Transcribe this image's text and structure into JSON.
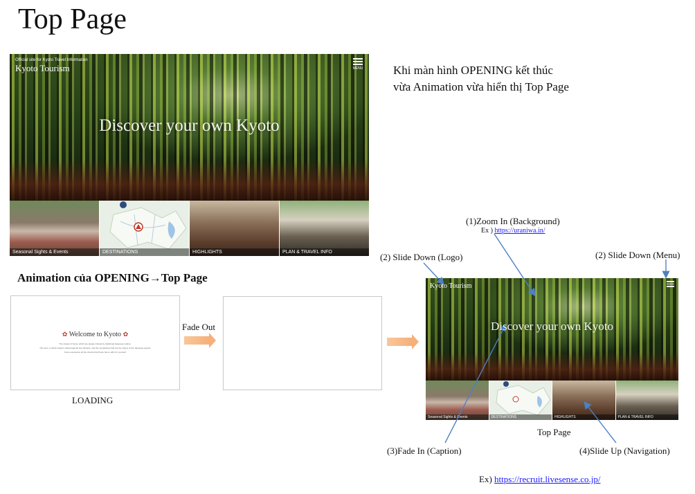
{
  "page_title": "Top Page",
  "hero_main": {
    "site_tagline": "Official site for Kyoto Travel Information",
    "logo": "Kyoto Tourism",
    "menu_label": "MENU",
    "caption": "Discover your own Kyoto"
  },
  "nav_tiles": [
    {
      "label": "Seasonal Sights & Events"
    },
    {
      "label": "DESTINATIONS"
    },
    {
      "label": "HIGHLIGHTS"
    },
    {
      "label": "PLAN & TRAVEL INFO"
    }
  ],
  "note": {
    "line1": "Khi màn hình OPENING kết thúc",
    "line2": "vừa Animation vừa hiển thị Top Page"
  },
  "animation_heading": "Animation của OPENING→Top Page",
  "loading": {
    "welcome_title": "Welcome to Kyoto",
    "welcome_text": [
      "The streets of Kyoto, which are deeply infused by traditional Japanese culture.",
      "The town, in which Japan's oldest legends are still alive, and the monasteries that are the origins of the Japanese people.",
      "Come experience all the charms that Kyoto has to offer for yourself."
    ],
    "label": "LOADING"
  },
  "fade_out_label": "Fade Out",
  "top_page_label": "Top Page",
  "small_preview": {
    "logo": "Kyoto Tourism",
    "caption": "Discover your own Kyoto"
  },
  "annotations": {
    "zoom_in": "(1)Zoom In (Background)",
    "zoom_in_ex_prefix": "Ex ) ",
    "zoom_in_ex_link": "https://uraniwa.in/",
    "slide_down_logo": "(2) Slide Down (Logo)",
    "slide_down_menu": "(2) Slide Down (Menu)",
    "fade_in_caption": "(3)Fade In (Caption)",
    "slide_up_nav": "(4)Slide Up (Navigation)",
    "ex2_prefix": "Ex) ",
    "ex2_link": "https://recruit.livesense.co.jp/"
  },
  "colors": {
    "arrow": "#f6b07a",
    "connector": "#4f7fc4",
    "link": "#1a1aff",
    "spell_underline": "#dd2222"
  }
}
